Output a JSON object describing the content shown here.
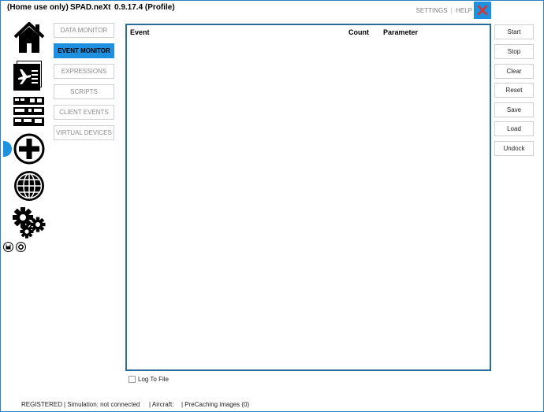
{
  "title": {
    "license": "(Home use only)",
    "app_name": "SPAD.neXt",
    "version": "0.9.17.4 (Profile)"
  },
  "top_links": {
    "settings": "SETTINGS",
    "separator": "|",
    "help": "HELP"
  },
  "nav_icons": [
    "home-icon",
    "flight-profile-icon",
    "devices-icon",
    "add-icon",
    "globe-icon",
    "gears-icon",
    "save-icon",
    "small-settings-icon"
  ],
  "nav_tabs": [
    {
      "label": "DATA MONITOR",
      "active": false
    },
    {
      "label": "EVENT MONITOR",
      "active": true
    },
    {
      "label": "EXPRESSIONS",
      "active": false
    },
    {
      "label": "SCRIPTS",
      "active": false
    },
    {
      "label": "CLIENT EVENTS",
      "active": false
    },
    {
      "label": "VIRTUAL DEVICES",
      "active": false
    }
  ],
  "table": {
    "columns": [
      "Event",
      "Count",
      "Parameter"
    ],
    "rows": []
  },
  "actions": [
    "Start",
    "Stop",
    "Clear",
    "Reset",
    "Save",
    "Load",
    "Undock"
  ],
  "log_to_file": {
    "label": "Log To File",
    "checked": false
  },
  "status_bar": {
    "registered": "REGISTERED",
    "simulation": "| Simulation: not connected",
    "aircraft": "| Aircraft:",
    "precaching": "| PreCaching images (0)"
  },
  "colors": {
    "accent": "#1e90e0",
    "panel_border": "#2b6d9b",
    "close_x": "#e0302a"
  }
}
